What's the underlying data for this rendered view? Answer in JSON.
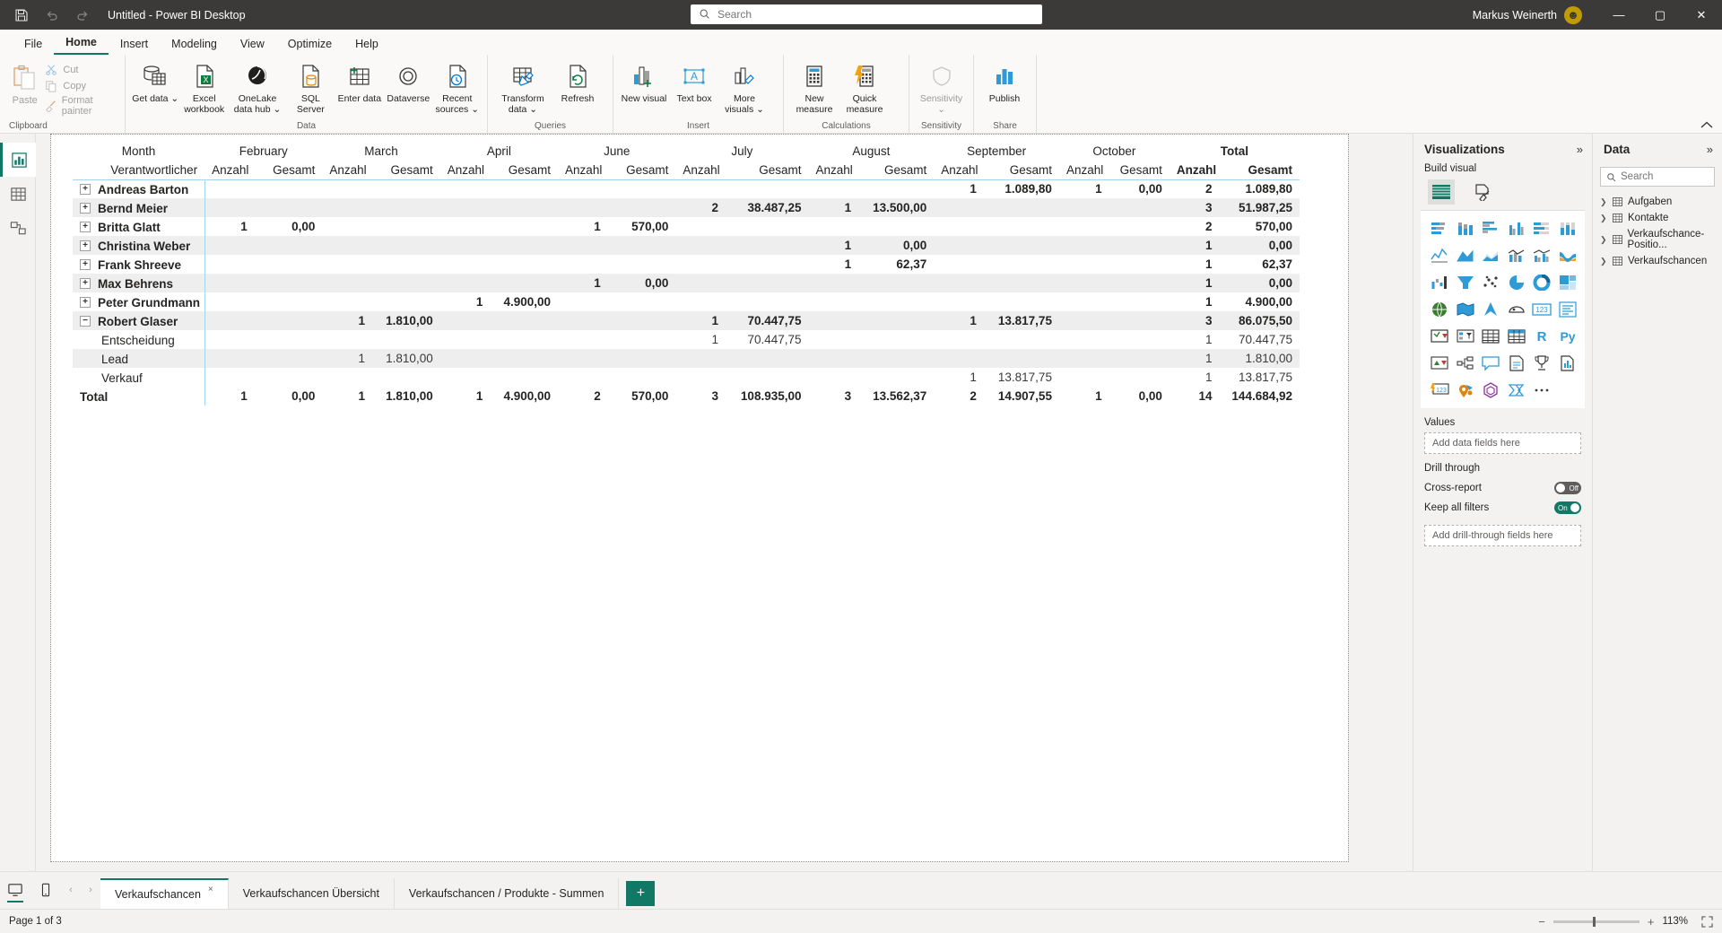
{
  "titlebar": {
    "save_icon": "save-icon",
    "undo_icon": "undo-icon",
    "redo_icon": "redo-icon",
    "title": "Untitled - Power BI Desktop",
    "search_placeholder": "Search",
    "user_name": "Markus Weinerth",
    "avatar_initial": "☻",
    "minimize": "—",
    "maximize": "▢",
    "close": "✕"
  },
  "menu": {
    "items": [
      {
        "label": "File",
        "active": false
      },
      {
        "label": "Home",
        "active": true
      },
      {
        "label": "Insert",
        "active": false
      },
      {
        "label": "Modeling",
        "active": false
      },
      {
        "label": "View",
        "active": false
      },
      {
        "label": "Optimize",
        "active": false
      },
      {
        "label": "Help",
        "active": false
      }
    ]
  },
  "ribbon": {
    "collapse_icon": "chevron-up-icon",
    "groups": [
      {
        "name": "Clipboard",
        "label": "Clipboard",
        "paste": "Paste",
        "cut": "Cut",
        "copy": "Copy",
        "format_painter": "Format painter"
      },
      {
        "name": "Data",
        "label": "Data",
        "buttons": [
          {
            "label": "Get data ⌄",
            "icon": "get-data-icon"
          },
          {
            "label": "Excel workbook",
            "icon": "excel-icon"
          },
          {
            "label": "OneLake data hub ⌄",
            "icon": "onelake-icon"
          },
          {
            "label": "SQL Server",
            "icon": "sql-server-icon"
          },
          {
            "label": "Enter data",
            "icon": "enter-data-icon"
          },
          {
            "label": "Dataverse",
            "icon": "dataverse-icon"
          },
          {
            "label": "Recent sources ⌄",
            "icon": "recent-sources-icon"
          }
        ]
      },
      {
        "name": "Queries",
        "label": "Queries",
        "buttons": [
          {
            "label": "Transform data ⌄",
            "icon": "transform-data-icon"
          },
          {
            "label": "Refresh",
            "icon": "refresh-icon"
          }
        ]
      },
      {
        "name": "Insert",
        "label": "Insert",
        "buttons": [
          {
            "label": "New visual",
            "icon": "new-visual-icon"
          },
          {
            "label": "Text box",
            "icon": "text-box-icon"
          },
          {
            "label": "More visuals ⌄",
            "icon": "more-visuals-icon"
          }
        ]
      },
      {
        "name": "Calculations",
        "label": "Calculations",
        "buttons": [
          {
            "label": "New measure",
            "icon": "new-measure-icon"
          },
          {
            "label": "Quick measure",
            "icon": "quick-measure-icon"
          }
        ]
      },
      {
        "name": "Sensitivity",
        "label": "Sensitivity",
        "buttons": [
          {
            "label": "Sensitivity ⌄",
            "icon": "sensitivity-icon"
          }
        ]
      },
      {
        "name": "Share",
        "label": "Share",
        "buttons": [
          {
            "label": "Publish",
            "icon": "publish-icon"
          }
        ]
      }
    ]
  },
  "leftrail": {
    "items": [
      {
        "name": "report-view",
        "icon": "report-view-icon",
        "active": true
      },
      {
        "name": "table-view",
        "icon": "table-view-icon",
        "active": false
      },
      {
        "name": "model-view",
        "icon": "model-view-icon",
        "active": false
      }
    ]
  },
  "matrix": {
    "corner_top": "Month",
    "corner_sub": "Verantwortlicher",
    "months": [
      "February",
      "March",
      "April",
      "June",
      "July",
      "August",
      "September",
      "October",
      "Total"
    ],
    "sub_headers": [
      "Anzahl",
      "Gesamt"
    ],
    "rows": [
      {
        "label": "Andreas Barton",
        "type": "parent",
        "expander": "+",
        "cells": [
          "",
          "",
          "",
          "",
          "",
          "",
          "",
          "",
          "",
          "",
          "",
          "",
          "1",
          "1.089,80",
          "1",
          "0,00"
        ],
        "total": [
          "2",
          "1.089,80"
        ]
      },
      {
        "label": "Bernd Meier",
        "type": "parent",
        "expander": "+",
        "cells": [
          "",
          "",
          "",
          "",
          "",
          "",
          "",
          "",
          "2",
          "38.487,25",
          "1",
          "13.500,00",
          "",
          "",
          "",
          ""
        ],
        "total": [
          "3",
          "51.987,25"
        ]
      },
      {
        "label": "Britta Glatt",
        "type": "parent",
        "expander": "+",
        "cells": [
          "1",
          "0,00",
          "",
          "",
          "",
          "",
          "1",
          "570,00",
          "",
          "",
          "",
          "",
          "",
          "",
          "",
          ""
        ],
        "total": [
          "2",
          "570,00"
        ]
      },
      {
        "label": "Christina Weber",
        "type": "parent",
        "expander": "+",
        "cells": [
          "",
          "",
          "",
          "",
          "",
          "",
          "",
          "",
          "",
          "",
          "1",
          "0,00",
          "",
          "",
          "",
          ""
        ],
        "total": [
          "1",
          "0,00"
        ]
      },
      {
        "label": "Frank Shreeve",
        "type": "parent",
        "expander": "+",
        "cells": [
          "",
          "",
          "",
          "",
          "",
          "",
          "",
          "",
          "",
          "",
          "1",
          "62,37",
          "",
          "",
          "",
          ""
        ],
        "total": [
          "1",
          "62,37"
        ]
      },
      {
        "label": "Max Behrens",
        "type": "parent",
        "expander": "+",
        "cells": [
          "",
          "",
          "",
          "",
          "",
          "",
          "1",
          "0,00",
          "",
          "",
          "",
          "",
          "",
          "",
          "",
          ""
        ],
        "total": [
          "1",
          "0,00"
        ]
      },
      {
        "label": "Peter Grundmann",
        "type": "parent",
        "expander": "+",
        "cells": [
          "",
          "",
          "",
          "",
          "1",
          "4.900,00",
          "",
          "",
          "",
          "",
          "",
          "",
          "",
          "",
          "",
          ""
        ],
        "total": [
          "1",
          "4.900,00"
        ]
      },
      {
        "label": "Robert Glaser",
        "type": "parent",
        "expander": "−",
        "cells": [
          "",
          "",
          "1",
          "1.810,00",
          "",
          "",
          "",
          "",
          "1",
          "70.447,75",
          "",
          "",
          "1",
          "13.817,75",
          "",
          ""
        ],
        "total": [
          "3",
          "86.075,50"
        ]
      },
      {
        "label": "Entscheidung",
        "type": "child",
        "expander": "",
        "cells": [
          "",
          "",
          "",
          "",
          "",
          "",
          "",
          "",
          "1",
          "70.447,75",
          "",
          "",
          "",
          "",
          "",
          ""
        ],
        "total": [
          "1",
          "70.447,75"
        ]
      },
      {
        "label": "Lead",
        "type": "child",
        "expander": "",
        "cells": [
          "",
          "",
          "1",
          "1.810,00",
          "",
          "",
          "",
          "",
          "",
          "",
          "",
          "",
          "",
          "",
          "",
          ""
        ],
        "total": [
          "1",
          "1.810,00"
        ]
      },
      {
        "label": "Verkauf",
        "type": "child",
        "expander": "",
        "cells": [
          "",
          "",
          "",
          "",
          "",
          "",
          "",
          "",
          "",
          "",
          "",
          "",
          "1",
          "13.817,75",
          "",
          ""
        ],
        "total": [
          "1",
          "13.817,75"
        ]
      },
      {
        "label": "Total",
        "type": "total",
        "expander": "",
        "cells": [
          "1",
          "0,00",
          "1",
          "1.810,00",
          "1",
          "4.900,00",
          "2",
          "570,00",
          "3",
          "108.935,00",
          "3",
          "13.562,37",
          "2",
          "14.907,55",
          "1",
          "0,00"
        ],
        "total": [
          "14",
          "144.684,92"
        ]
      }
    ]
  },
  "visualizations": {
    "title": "Visualizations",
    "collapse_icon": "chevron-right-double-icon",
    "build_label": "Build visual",
    "tabs": [
      {
        "name": "build-visual-tab",
        "icon": "matrix-visual-icon",
        "selected": true
      },
      {
        "name": "format-visual-tab",
        "icon": "format-paint-icon",
        "selected": false
      }
    ],
    "gallery": [
      "stacked-bar-chart-icon",
      "stacked-column-chart-icon",
      "clustered-bar-chart-icon",
      "clustered-column-chart-icon",
      "100-stacked-bar-chart-icon",
      "100-stacked-column-chart-icon",
      "line-chart-icon",
      "area-chart-icon",
      "stacked-area-chart-icon",
      "line-stacked-column-chart-icon",
      "line-clustered-column-chart-icon",
      "ribbon-chart-icon",
      "waterfall-chart-icon",
      "funnel-chart-icon",
      "scatter-chart-icon",
      "pie-chart-icon",
      "donut-chart-icon",
      "treemap-icon",
      "map-icon",
      "filled-map-icon",
      "azure-map-icon",
      "arcgis-map-icon",
      "card-icon",
      "multi-row-card-icon",
      "kpi-icon",
      "slicer-icon",
      "table-icon",
      "matrix-icon",
      "r-script-icon",
      "python-script-icon",
      "key-influencers-icon",
      "decomposition-tree-icon",
      "qa-icon",
      "narrative-icon",
      "metrics-icon",
      "paginated-report-icon",
      "power-apps-icon",
      "arcgis-maps-icon",
      "visio-icon",
      "power-automate-icon",
      "more-options-icon"
    ],
    "values_label": "Values",
    "values_placeholder": "Add data fields here",
    "drill_through_label": "Drill through",
    "cross_report_label": "Cross-report",
    "cross_report_state": "Off",
    "keep_all_filters_label": "Keep all filters",
    "keep_all_filters_state": "On",
    "drill_through_placeholder": "Add drill-through fields here"
  },
  "data_pane": {
    "title": "Data",
    "collapse_icon": "chevron-right-double-icon",
    "search_placeholder": "Search",
    "search_icon": "search-icon",
    "tables": [
      {
        "label": "Aufgaben",
        "icon": "table-icon"
      },
      {
        "label": "Kontakte",
        "icon": "table-icon"
      },
      {
        "label": "Verkaufschance-Positio...",
        "icon": "table-icon"
      },
      {
        "label": "Verkaufschancen",
        "icon": "table-icon"
      }
    ]
  },
  "bottom": {
    "views": [
      {
        "name": "desktop-view",
        "icon": "desktop-icon",
        "active": true
      },
      {
        "name": "mobile-view",
        "icon": "mobile-icon",
        "active": false
      }
    ],
    "nav_prev": "‹",
    "nav_next": "›",
    "tabs": [
      {
        "label": "Verkaufschancen",
        "active": true,
        "close": "×"
      },
      {
        "label": "Verkaufschancen Übersicht",
        "active": false,
        "close": ""
      },
      {
        "label": "Verkaufschancen / Produkte - Summen",
        "active": false,
        "close": ""
      }
    ],
    "add_tab": "+"
  },
  "statusbar": {
    "page_text": "Page 1 of 3",
    "zoom_out": "−",
    "zoom_in": "+",
    "zoom_value": "113%",
    "fit_icon": "fit-to-page-icon"
  }
}
